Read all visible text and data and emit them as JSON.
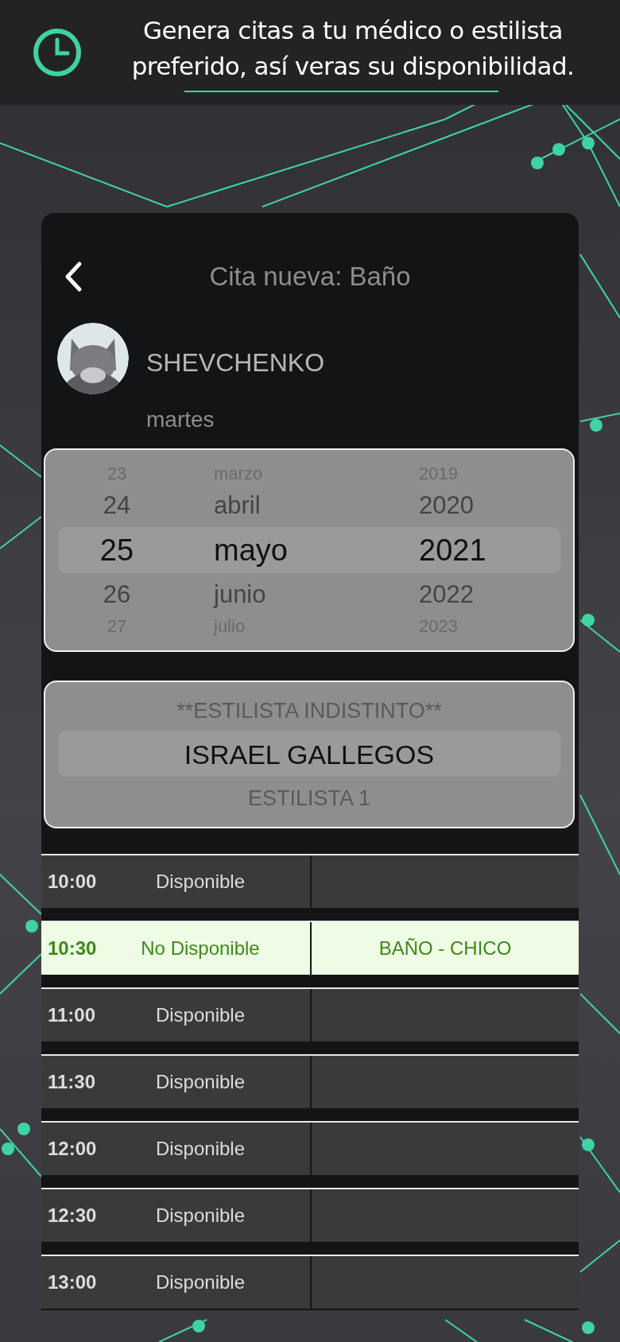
{
  "banner": {
    "text": "Genera citas a tu médico o estilista preferido, así veras su disponibilidad."
  },
  "screen": {
    "title": "Cita nueva: Baño",
    "stylist": "SHEVCHENKO",
    "weekday": "martes"
  },
  "date_picker": {
    "columns": [
      {
        "items": [
          {
            "label": "23",
            "selected": false
          },
          {
            "label": "24",
            "selected": false
          },
          {
            "label": "25",
            "selected": true
          },
          {
            "label": "26",
            "selected": false
          },
          {
            "label": "27",
            "selected": false
          }
        ]
      },
      {
        "items": [
          {
            "label": "marzo",
            "selected": false
          },
          {
            "label": "abril",
            "selected": false
          },
          {
            "label": "mayo",
            "selected": true
          },
          {
            "label": "junio",
            "selected": false
          },
          {
            "label": "julio",
            "selected": false
          }
        ]
      },
      {
        "items": [
          {
            "label": "2019",
            "selected": false
          },
          {
            "label": "2020",
            "selected": false
          },
          {
            "label": "2021",
            "selected": true
          },
          {
            "label": "2022",
            "selected": false
          },
          {
            "label": "2023",
            "selected": false
          }
        ]
      }
    ]
  },
  "stylist_picker": {
    "items": [
      {
        "label": "**ESTILISTA INDISTINTO**",
        "selected": false
      },
      {
        "label": "ISRAEL GALLEGOS",
        "selected": true
      },
      {
        "label": "ESTILISTA 1",
        "selected": false
      }
    ]
  },
  "slots": [
    {
      "time": "10:00",
      "status": "Disponible",
      "available": true
    },
    {
      "time": "10:30",
      "status": "No Disponible",
      "detail": "BAÑO - CHICO",
      "available": false
    },
    {
      "time": "11:00",
      "status": "Disponible",
      "available": true
    },
    {
      "time": "11:30",
      "status": "Disponible",
      "available": true
    },
    {
      "time": "12:00",
      "status": "Disponible",
      "available": true
    },
    {
      "time": "12:30",
      "status": "Disponible",
      "available": true
    },
    {
      "time": "13:00",
      "status": "Disponible",
      "available": true
    }
  ]
}
